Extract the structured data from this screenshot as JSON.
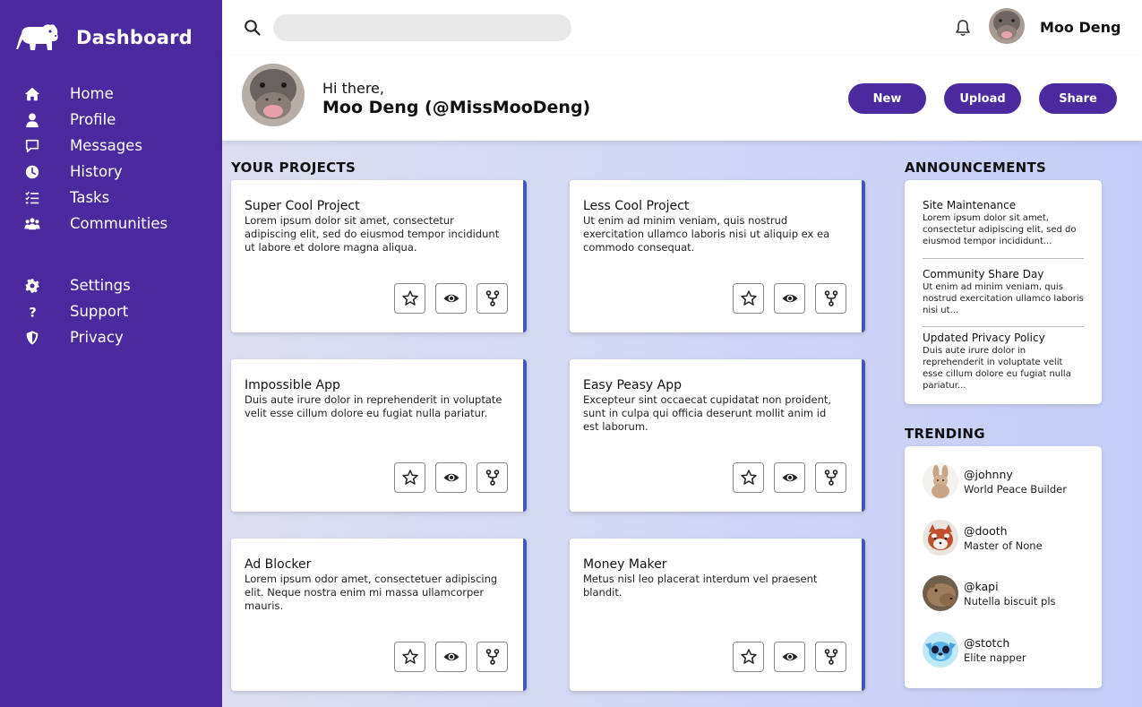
{
  "brand": {
    "title": "Dashboard",
    "logo": "hippo-logo-icon"
  },
  "nav_primary": [
    {
      "label": "Home",
      "icon": "home-icon"
    },
    {
      "label": "Profile",
      "icon": "user-icon"
    },
    {
      "label": "Messages",
      "icon": "message-icon"
    },
    {
      "label": "History",
      "icon": "clock-icon"
    },
    {
      "label": "Tasks",
      "icon": "checklist-icon"
    },
    {
      "label": "Communities",
      "icon": "people-icon"
    }
  ],
  "nav_secondary": [
    {
      "label": "Settings",
      "icon": "gear-icon"
    },
    {
      "label": "Support",
      "icon": "question-icon"
    },
    {
      "label": "Privacy",
      "icon": "shield-icon"
    }
  ],
  "topbar": {
    "search_value": "",
    "user_name": "Moo Deng"
  },
  "header": {
    "greeting": "Hi there,",
    "handle": "Moo Deng (@MissMooDeng)",
    "buttons": {
      "new": "New",
      "upload": "Upload",
      "share": "Share"
    }
  },
  "projects": {
    "heading": "YOUR PROJECTS",
    "items": [
      {
        "title": "Super Cool Project",
        "description": "Lorem ipsum dolor sit amet, consectetur adipiscing elit, sed do eiusmod tempor incididunt ut labore et dolore magna aliqua."
      },
      {
        "title": "Less Cool Project",
        "description": "Ut enim ad minim veniam, quis nostrud exercitation ullamco laboris nisi ut aliquip ex ea commodo consequat."
      },
      {
        "title": "Impossible App",
        "description": "Duis aute irure dolor in reprehenderit in voluptate velit esse cillum dolore eu fugiat nulla pariatur."
      },
      {
        "title": "Easy Peasy App",
        "description": "Excepteur sint occaecat cupidatat non proident, sunt in culpa qui officia deserunt mollit anim id est laborum."
      },
      {
        "title": "Ad Blocker",
        "description": "Lorem ipsum odor amet, consectetuer adipiscing elit. Neque nostra enim mi massa ullamcorper mauris."
      },
      {
        "title": "Money Maker",
        "description": "Metus nisl leo placerat interdum vel praesent blandit."
      }
    ]
  },
  "announcements": {
    "heading": "ANNOUNCEMENTS",
    "items": [
      {
        "title": "Site Maintenance",
        "text": "Lorem ipsum dolor sit amet, consectetur adipiscing elit, sed do eiusmod tempor incididunt..."
      },
      {
        "title": "Community Share Day",
        "text": "Ut enim ad minim veniam, quis nostrud exercitation ullamco laboris nisi ut..."
      },
      {
        "title": "Updated Privacy Policy",
        "text": "Duis aute irure dolor in reprehenderit in voluptate velit esse cillum dolore eu fugiat nulla pariatur..."
      }
    ]
  },
  "trending": {
    "heading": "TRENDING",
    "items": [
      {
        "handle": "@johnny",
        "subtitle": "World Peace Builder"
      },
      {
        "handle": "@dooth",
        "subtitle": "Master of None"
      },
      {
        "handle": "@kapi",
        "subtitle": "Nutella biscuit pls"
      },
      {
        "handle": "@stotch",
        "subtitle": "Elite napper"
      }
    ]
  },
  "colors": {
    "sidebar": "#4a2a9e",
    "accent": "#4a2a9e",
    "card_edge": "#4656b8",
    "background_gradient_start": "#dcdff0",
    "background_gradient_end": "#c5cdf7"
  }
}
